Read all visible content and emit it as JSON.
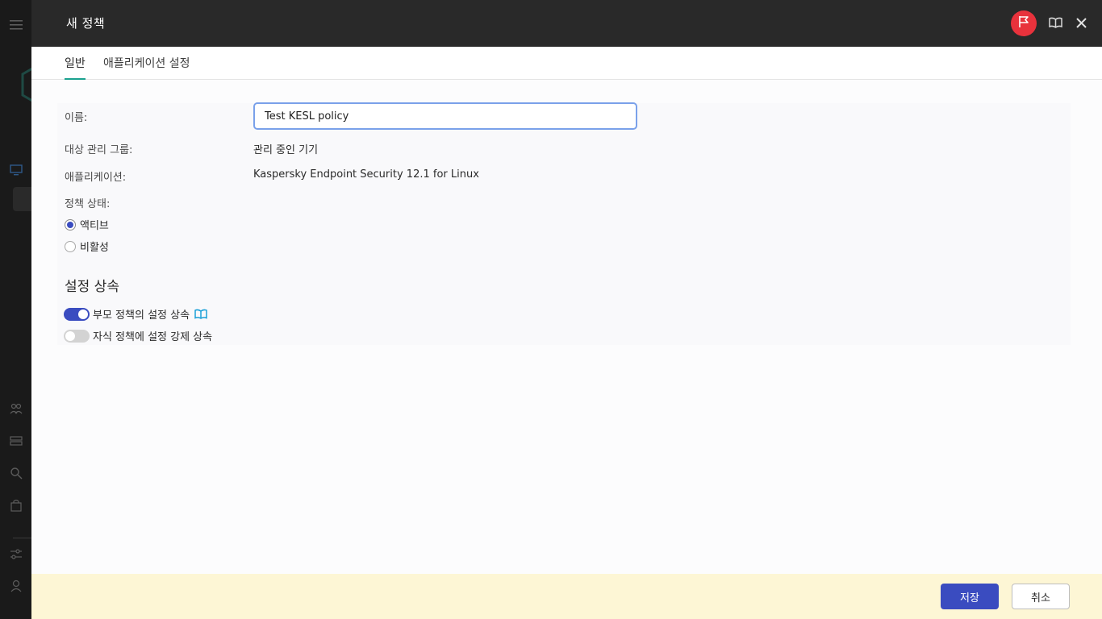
{
  "dialog": {
    "title": "새 정책"
  },
  "tabs": [
    {
      "label": "일반"
    },
    {
      "label": "애플리케이션 설정"
    }
  ],
  "form": {
    "name_label": "이름:",
    "name_value": "Test KESL policy",
    "group_label": "대상 관리 그룹:",
    "group_value": "관리 중인 기기",
    "app_label": "애플리케이션:",
    "app_value": "Kaspersky Endpoint Security 12.1 for Linux",
    "status_label": "정책 상태:",
    "status_options": [
      {
        "label": "액티브",
        "selected": true
      },
      {
        "label": "비활성",
        "selected": false
      }
    ]
  },
  "inheritance": {
    "title": "설정 상속",
    "toggles": [
      {
        "label": "부모 정책의 설정 상속",
        "on": true
      },
      {
        "label": "자식 정책에 설정 강제 상속",
        "on": false
      }
    ]
  },
  "footer": {
    "save_label": "저장",
    "cancel_label": "취소"
  },
  "colors": {
    "accent": "#3a4cc0",
    "tab_underline": "#1ba28f",
    "flag_button": "#e8323c",
    "footer_bg": "#fdf6d5"
  },
  "icons": {
    "header": [
      "flag-icon",
      "book-icon",
      "close-icon"
    ],
    "rail": [
      "menu-icon",
      "logo-icon",
      "monitor-icon",
      "users-icon",
      "servers-icon",
      "search-icon",
      "bag-icon",
      "sliders-icon",
      "person-icon"
    ]
  }
}
